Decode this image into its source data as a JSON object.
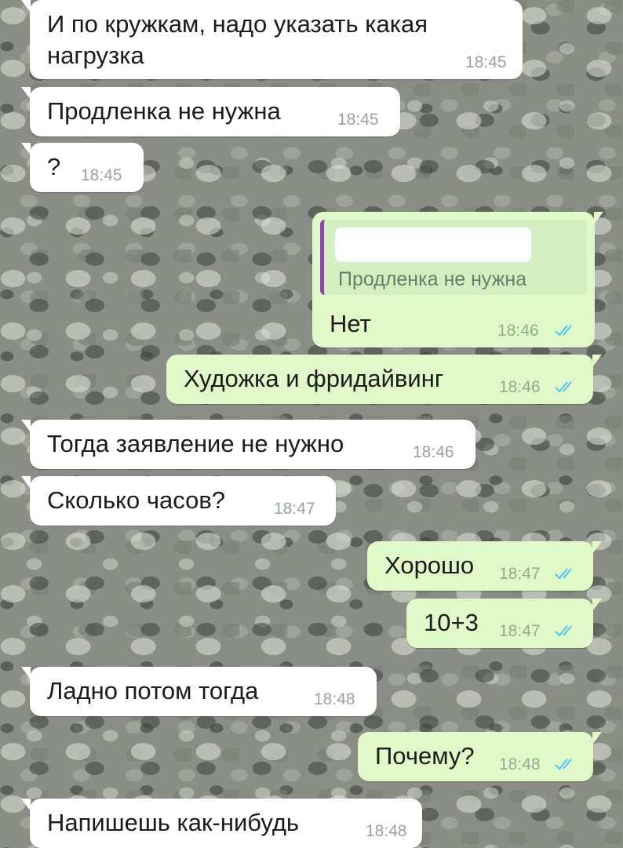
{
  "messages": [
    {
      "direction": "in",
      "text": "И по кружкам, надо указать какая",
      "text2": "нагрузка",
      "time": "18:45"
    },
    {
      "direction": "in",
      "text": "Продленка не нужна",
      "time": "18:45"
    },
    {
      "direction": "in",
      "text": "?",
      "time": "18:45"
    },
    {
      "direction": "out",
      "quote_text": "Продленка не нужна",
      "text": "Нет",
      "time": "18:46",
      "status": "read"
    },
    {
      "direction": "out",
      "text": "Художка и фридайвинг",
      "time": "18:46",
      "status": "read"
    },
    {
      "direction": "in",
      "text": "Тогда заявление не нужно",
      "time": "18:46"
    },
    {
      "direction": "in",
      "text": "Сколько часов?",
      "time": "18:47"
    },
    {
      "direction": "out",
      "text": "Хорошо",
      "time": "18:47",
      "status": "read"
    },
    {
      "direction": "out",
      "text": "10+3",
      "time": "18:47",
      "status": "read"
    },
    {
      "direction": "in",
      "text": "Ладно потом тогда",
      "time": "18:48"
    },
    {
      "direction": "out",
      "text": "Почему?",
      "time": "18:48",
      "status": "read"
    },
    {
      "direction": "in",
      "text": "Напишешь как-нибудь",
      "time": "18:48"
    }
  ],
  "colors": {
    "incoming_bubble": "#ffffff",
    "outgoing_bubble": "#e1f9c9",
    "read_ticks": "#4fc3f7",
    "quote_bar": "#8e44ad"
  },
  "icons": {
    "read_status": "double-check-icon"
  }
}
